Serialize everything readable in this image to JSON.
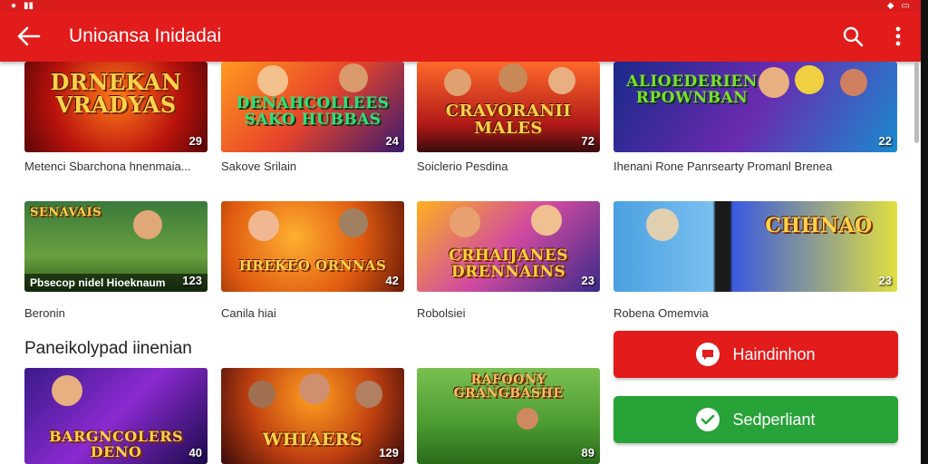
{
  "appbar": {
    "title": "Unioansa Inidadai",
    "back_icon": "arrow-back-icon",
    "search_icon": "search-icon",
    "menu_icon": "more-vert-icon",
    "color": "#e21b1b"
  },
  "grid": {
    "row1": [
      {
        "logo": "DRNEKAN VRADYAS",
        "count": "29",
        "caption": "Metenci Sbarchona hnenmaia..."
      },
      {
        "logo": "DENAHCOLLEES SAKO HUBBAS",
        "count": "24",
        "caption": "Sakove Srilain"
      },
      {
        "logo": "CRAVORANII MALES",
        "count": "72",
        "caption": "Soiclerio Pesdina"
      },
      {
        "logo": "ALIOEDERIEN RPOWNBAN",
        "count": "22",
        "caption": "Ihenani Rone Panrsearty Promanl Brenea"
      }
    ],
    "row2": [
      {
        "logo": "SENAVAIS",
        "strip": "Pbsecop nidel Hioeknaum",
        "count": "123",
        "caption": "Beronin"
      },
      {
        "logo": "HREKEO ORNNAS",
        "count": "42",
        "caption": "Canila hiai"
      },
      {
        "logo": "CRHAIJANES DRENNAINS",
        "count": "23",
        "caption": "Robolsiei"
      },
      {
        "logo": "CHHNAO",
        "count": "23",
        "caption": "Robena Omemvia"
      }
    ],
    "row3": [
      {
        "logo": "BARGNCOLERS DENO",
        "count": "40"
      },
      {
        "logo": "WHIAERS",
        "count": "129"
      },
      {
        "logo": "RAFOONY GRANGBASHE",
        "count": "89"
      }
    ]
  },
  "section_title": "Paneikolypad iinenian",
  "buttons": {
    "red": {
      "label": "Haindinhon",
      "icon": "chat-icon",
      "color": "#e21b1b"
    },
    "green": {
      "label": "Sedperliant",
      "icon": "check-icon",
      "color": "#27a337"
    }
  }
}
